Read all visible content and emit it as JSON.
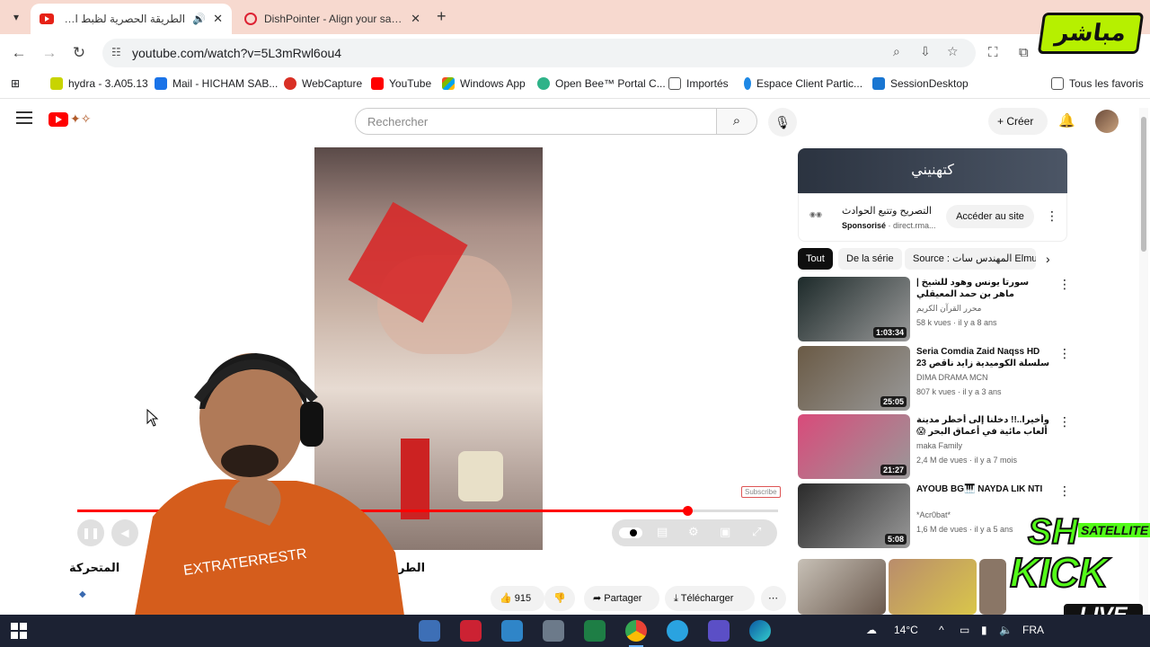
{
  "browser": {
    "tabs": [
      {
        "title": "الطريقة الحصرية لظبط المدا",
        "active": true
      },
      {
        "title": "DishPointer - Align your satellit",
        "active": false
      }
    ],
    "url": "youtube.com/watch?v=5L3mRwl6ou4",
    "bookmarks": [
      {
        "label": "hydra - 3.A05.13"
      },
      {
        "label": "Mail - HICHAM SAB..."
      },
      {
        "label": "WebCapture"
      },
      {
        "label": "YouTube"
      },
      {
        "label": "Windows App"
      },
      {
        "label": "Open Bee™ Portal C..."
      },
      {
        "label": "Importés"
      },
      {
        "label": "Espace Client Partic..."
      },
      {
        "label": "SessionDesktop"
      }
    ],
    "all_bookmarks": "Tous les favoris"
  },
  "youtube": {
    "search_placeholder": "Rechercher",
    "create_label": "Créer",
    "video_title_left": "المتحركة",
    "video_title_mid": "الطر",
    "progress": 0.87,
    "likes": "915",
    "share_label": "Partager",
    "download_label": "Télécharger",
    "watermark": "Subscribe",
    "ad": {
      "banner_text": "كتهنيني",
      "title": "التصريح وتتبع الحوادث",
      "sponsored": "Sponsorisé",
      "domain": "direct.rma...",
      "visit_label": "Accéder au site"
    },
    "chips": [
      "Tout",
      "De la série",
      "Source : المهندس سات Elmuhand"
    ],
    "recommendations": [
      {
        "title": "سورتا يونس وهود للشيخ | ماهر بن حمد المعيقلي",
        "channel": "محرر القرآن الكريم",
        "meta": "58 k vues · il y a 8 ans",
        "duration": "1:03:34",
        "thumb_color": "#1d2a2a"
      },
      {
        "title": "Seria Comdia Zaid Naqss HD 23 سلسلة الكوميدية زايد ناقص حلقة",
        "channel": "DIMA DRAMA MCN",
        "meta": "807 k vues · il y a 3 ans",
        "duration": "25:05",
        "thumb_color": "#6a5a45"
      },
      {
        "title": "وأخيرا..!! دخلنا إلى أخطر مدينة ألعاب مائية في أعماق البحر 😱 (رانيا ...",
        "channel": "maka Family",
        "meta": "2,4 M de vues · il y a 7 mois",
        "duration": "21:27",
        "thumb_color": "#d94a7a"
      },
      {
        "title": "AYOUB BG🎹 NAYDA LIK NTI",
        "channel": "*Acr0bat*",
        "meta": "1,6 M de vues · il y a 5 ans",
        "duration": "5:08",
        "thumb_color": "#2a2a2a"
      }
    ]
  },
  "overlay": {
    "badge": "مباشر",
    "kick_sh": "SH",
    "kick_sat": "SATELLITE",
    "kick": "KICK",
    "live": "LIVE"
  },
  "taskbar": {
    "temperature": "14°C",
    "language": "FRA"
  }
}
